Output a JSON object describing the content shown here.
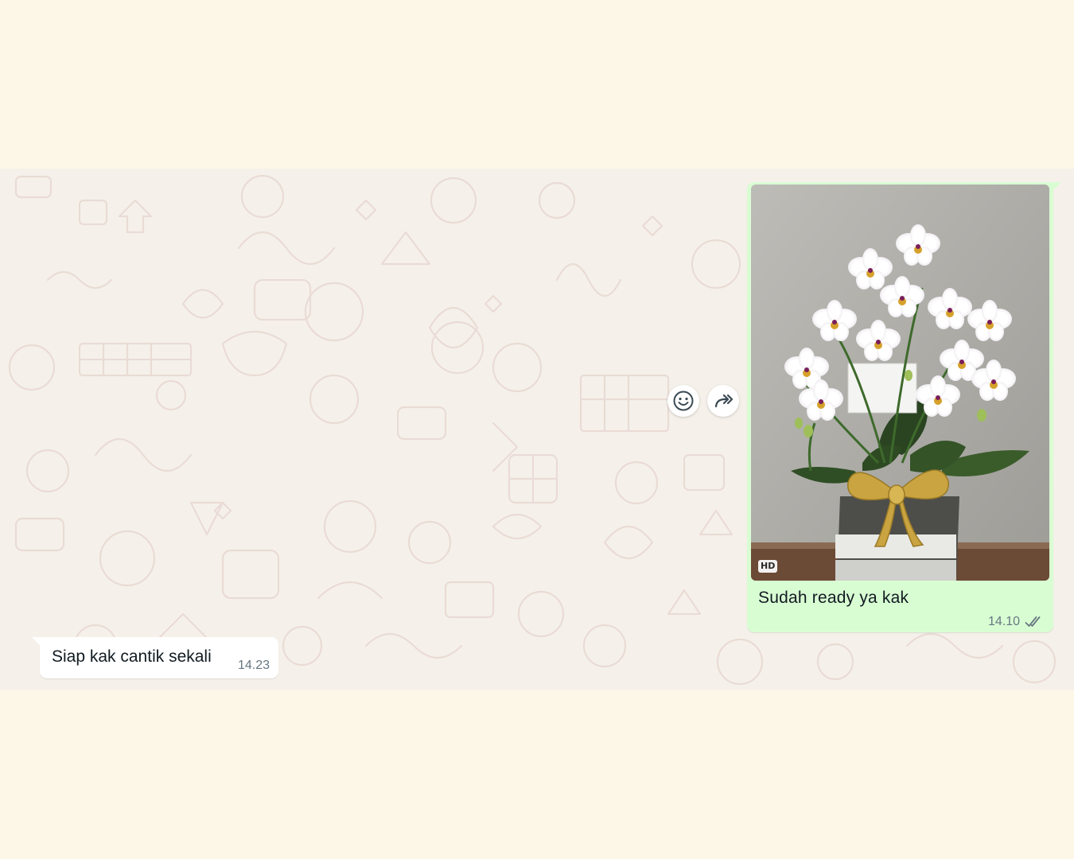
{
  "colors": {
    "page_background": "#fdf7e7",
    "chat_wallpaper": "#f5f1ea",
    "outgoing_bubble": "#d9fdd3",
    "incoming_bubble": "#ffffff",
    "read_ticks": "#667781"
  },
  "messages": {
    "outgoing": {
      "badge": "HD",
      "caption": "Sudah ready ya kak",
      "time": "14.10",
      "status_icon": "double-check-icon"
    },
    "incoming": {
      "text": "Siap kak cantik sekali",
      "time": "14.23"
    }
  },
  "actions": {
    "react_icon": "smiley-icon",
    "forward_icon": "forward-icon"
  }
}
